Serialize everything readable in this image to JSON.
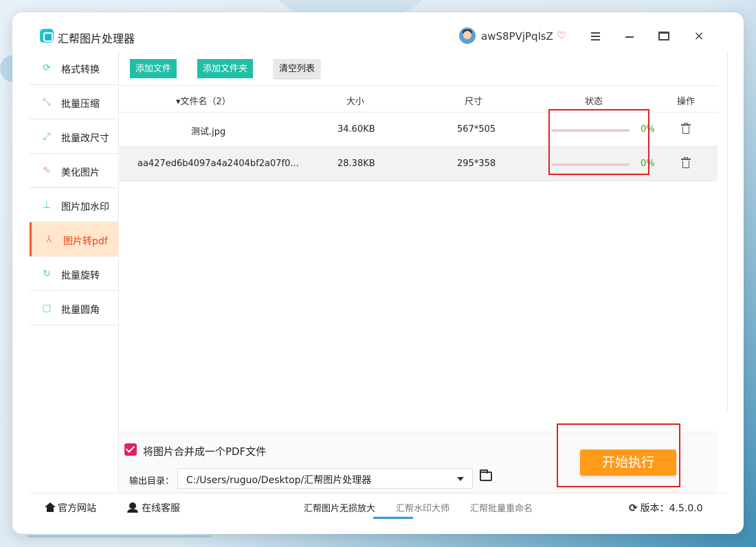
{
  "app": {
    "title": "汇帮图片处理器"
  },
  "user": {
    "name": "awS8PVjPqlsZ"
  },
  "titlebar": {
    "close_glyph": "×"
  },
  "sidebar": {
    "items": [
      {
        "label": "格式转换",
        "icon": "format-convert-icon"
      },
      {
        "label": "批量压缩",
        "icon": "compress-icon"
      },
      {
        "label": "批量改尺寸",
        "icon": "resize-icon"
      },
      {
        "label": "美化图片",
        "icon": "beautify-icon"
      },
      {
        "label": "图片加水印",
        "icon": "watermark-icon"
      },
      {
        "label": "图片转pdf",
        "icon": "pdf-icon",
        "active": true
      },
      {
        "label": "批量旋转",
        "icon": "rotate-icon"
      },
      {
        "label": "批量圆角",
        "icon": "round-corner-icon"
      }
    ]
  },
  "toolbar": {
    "add_file": "添加文件",
    "add_folder": "添加文件夹",
    "clear_list": "清空列表"
  },
  "table": {
    "headers": {
      "filename": "文件名（2）",
      "size": "大小",
      "dimensions": "尺寸",
      "status": "状态",
      "actions": "操作"
    },
    "rows": [
      {
        "filename": "测试.jpg",
        "size": "34.60KB",
        "dimensions": "567*505",
        "progress": 0,
        "progress_text": "0%"
      },
      {
        "filename": "aa427ed6b4097a4a2404bf2a07f0...",
        "size": "28.38KB",
        "dimensions": "295*358",
        "progress": 0,
        "progress_text": "0%"
      }
    ]
  },
  "options": {
    "merge_checked": true,
    "merge_label": "将图片合并成一个PDF文件",
    "output_label": "输出目录：",
    "output_path": "C:/Users/ruguo/Desktop/汇帮图片处理器"
  },
  "start_button": "开始执行",
  "footer": {
    "website": "官方网站",
    "support": "在线客服",
    "links": [
      "汇帮图片无损放大",
      "汇帮水印大师",
      "汇帮批量重命名"
    ],
    "version_label": "版本：",
    "version": "4.5.0.0"
  },
  "colors": {
    "accent_green": "#1fbfa6",
    "accent_orange": "#ff9a1a",
    "active_red": "#e8431c",
    "highlight_box": "#e02020"
  }
}
